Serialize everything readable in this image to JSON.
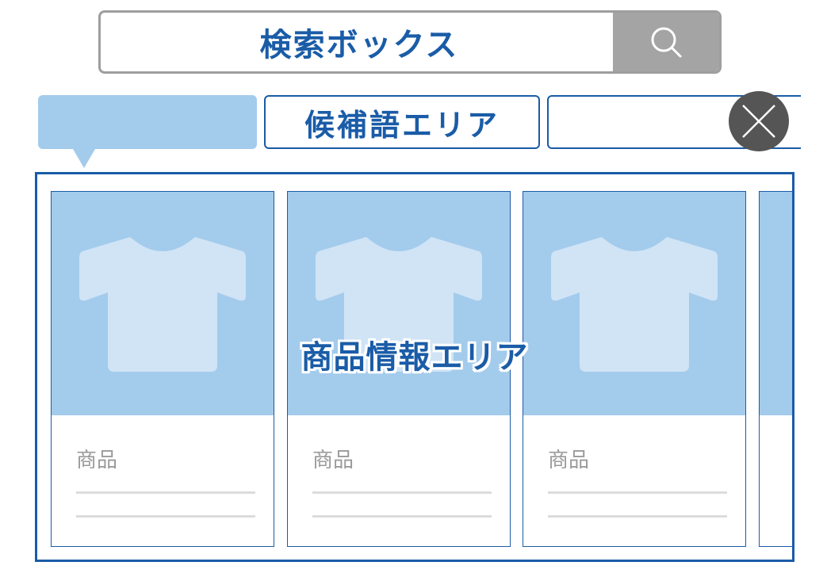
{
  "search": {
    "label": "検索ボックス",
    "button_icon": "search-icon"
  },
  "suggestions": {
    "items": [
      "",
      "候補語エリア",
      ""
    ],
    "close_icon": "close-icon"
  },
  "products": {
    "area_label": "商品情報エリア",
    "cards": [
      {
        "title": "商品",
        "image_icon": "tshirt-icon"
      },
      {
        "title": "商品",
        "image_icon": "tshirt-icon"
      },
      {
        "title": "商品",
        "image_icon": "tshirt-icon"
      }
    ]
  },
  "colors": {
    "accent": "#1a5ca7",
    "light_blue": "#a3cbec",
    "tshirt": "#d0e4f5",
    "gray": "#a4a4a4",
    "dark_gray": "#555555"
  }
}
